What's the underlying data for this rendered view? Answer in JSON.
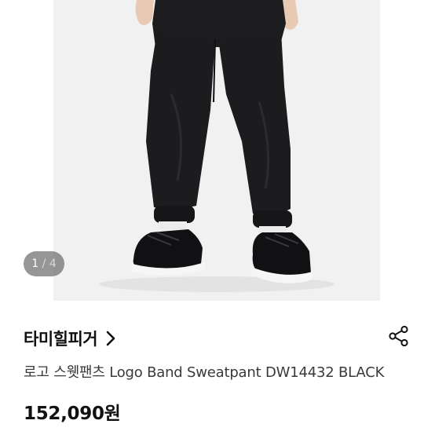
{
  "gallery": {
    "counter": {
      "current": "1",
      "separator": "/",
      "total": "4"
    }
  },
  "product": {
    "brand": "타미힐피거",
    "title": "로고 스웻팬츠 Logo Band Sweatpant DW14432 BLACK",
    "price": "152,090원"
  },
  "icons": {
    "brand_chevron": "chevron-right-icon",
    "share": "share-icon"
  },
  "colors": {
    "text_primary": "#111111",
    "text_secondary": "#3a3a3a",
    "counter_bg": "#6e6e6e"
  }
}
